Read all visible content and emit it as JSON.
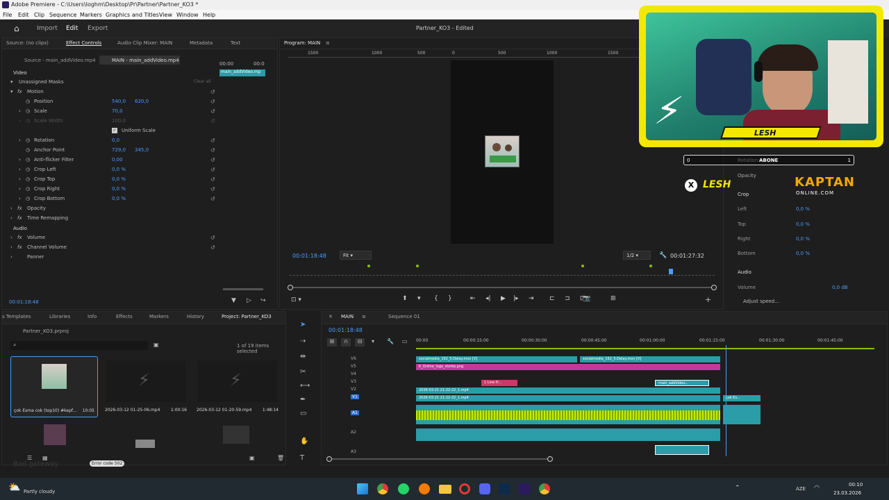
{
  "window": {
    "title": "Adobe Premiere - C:\\Users\\Ioghm\\Desktop\\Pr\\Partner\\Partner_KO3 *",
    "controls": [
      "—",
      "☐",
      "✕"
    ]
  },
  "menu": [
    "File",
    "Edit",
    "Clip",
    "Sequence",
    "Markers",
    "Graphics and Titles",
    "View",
    "Window",
    "Help"
  ],
  "workspace": {
    "tabs": [
      "Import",
      "Edit",
      "Export"
    ],
    "doc_title": "Partner_KO3 - Edited"
  },
  "effect_controls": {
    "tabs": [
      "Source: (no clips)",
      "Effect Controls",
      "Audio Clip Mixer: MAIN",
      "Metadata",
      "Text"
    ],
    "source": "Source - main_addVideo.mp4",
    "target": "MAIN - main_addVideo.mp4",
    "timecodes": [
      "00:00",
      "00:0"
    ],
    "clip_chip": "main_addVideo.mp",
    "section_video": "Video",
    "clear_all": "Clear all",
    "section_audio": "Audio",
    "rows": [
      {
        "label": "Unassigned Masks",
        "v1": "",
        "v2": ""
      },
      {
        "label": "Motion",
        "v1": "",
        "v2": ""
      },
      {
        "label": "Position",
        "v1": "540,0",
        "v2": "620,0"
      },
      {
        "label": "Scale",
        "v1": "70,0",
        "v2": ""
      },
      {
        "label": "Scale Width",
        "v1": "100,0",
        "v2": ""
      },
      {
        "label": "Uniform Scale",
        "v1": "",
        "v2": ""
      },
      {
        "label": "Rotation",
        "v1": "0,0",
        "v2": ""
      },
      {
        "label": "Anchor Point",
        "v1": "729,0",
        "v2": "345,0"
      },
      {
        "label": "Anti-flicker Filter",
        "v1": "0,00",
        "v2": ""
      },
      {
        "label": "Crop Left",
        "v1": "0,0 %",
        "v2": ""
      },
      {
        "label": "Crop Top",
        "v1": "0,0 %",
        "v2": ""
      },
      {
        "label": "Crop Right",
        "v1": "0,0 %",
        "v2": ""
      },
      {
        "label": "Crop Bottom",
        "v1": "0,0 %",
        "v2": ""
      },
      {
        "label": "Opacity",
        "v1": "",
        "v2": ""
      },
      {
        "label": "Time Remapping",
        "v1": "",
        "v2": ""
      }
    ],
    "audio_rows": [
      "Volume",
      "Channel Volume",
      "Panner"
    ],
    "timecode": "00:01:18:48"
  },
  "program": {
    "title": "Program: MAIN",
    "ruler": [
      "1500",
      "1000",
      "500",
      "0",
      "500",
      "1000",
      "1500"
    ],
    "timecode": "00:01:18:48",
    "fit": "Fit",
    "quality": "1/2",
    "duration": "00:01:27:32"
  },
  "overlay": {
    "name": "LESH",
    "counter_left": "0",
    "counter_label": "ABONE",
    "counter_right": "1",
    "social": "LESH",
    "brand_top": "KAPTAN",
    "brand_bottom": "ONLINE.COM",
    "rotation_label": "Rotation",
    "opacity": "Opacity",
    "crop": "Crop",
    "crop_rows": [
      {
        "label": "Left",
        "val": "0,0 %"
      },
      {
        "label": "Top",
        "val": "0,0 %"
      },
      {
        "label": "Right",
        "val": "0,0 %"
      },
      {
        "label": "Bottom",
        "val": "0,0 %"
      }
    ],
    "audio": "Audio",
    "volume": "Volume",
    "volume_val": "0,0 dB",
    "adjust": "Adjust speed..."
  },
  "project": {
    "tabs": [
      "s Templates",
      "Libraries",
      "Info",
      "Effects",
      "Markers",
      "History",
      "Project: Partner_KO3"
    ],
    "file": "Partner_KO3.prproj",
    "items_info": "1 of 19 items selected",
    "items": [
      {
        "name": "çok Esma cok (top10) #kepf...",
        "dur": "10:05"
      },
      {
        "name": "2026-03-12 01-25-06.mp4",
        "dur": "1:00:16"
      },
      {
        "name": "2026-03-12 01-20-59.mp4",
        "dur": "1:48:14"
      }
    ],
    "error": "Error code 502",
    "ghost": "Bad gateway"
  },
  "timeline": {
    "tabs": [
      "MAIN",
      "Sequence 01"
    ],
    "timecode": "00:01:18:48",
    "ruler": [
      "00:00",
      "00:00:15:00",
      "00:00:30:00",
      "00:00:45:00",
      "00:01:00:00",
      "00:01:15:00",
      "00:01:30:00",
      "00:01:45:00"
    ],
    "tracks": [
      "V6",
      "V5",
      "V4",
      "V3",
      "V2",
      "V1",
      "A1",
      "A2",
      "A3"
    ],
    "clips": {
      "v6a": "socialmedia_192_5:Delay.mov [V]",
      "v6b": "socialmedia_192_5:Delay.mov [V]",
      "v5": "K_Online_logo_storke.png",
      "v3a": "1 Line H...",
      "v3b": "main_addVideo...",
      "v2": "2026-03-21 21-22-22_1.mp4",
      "v1": "2026-03-21 21-22-22_1.mp4",
      "v1b": "çok Es..."
    }
  },
  "taskbar": {
    "weather": "Partly cloudy",
    "lang": "AZE",
    "time": "00:10",
    "date": "23.03.2026"
  },
  "colors": {
    "accent": "#4b9cff",
    "clip_teal": "#2a9da8",
    "clip_pink": "#c03a9e",
    "audio_green": "#a8d000",
    "overlay_yellow": "#f4e800"
  }
}
